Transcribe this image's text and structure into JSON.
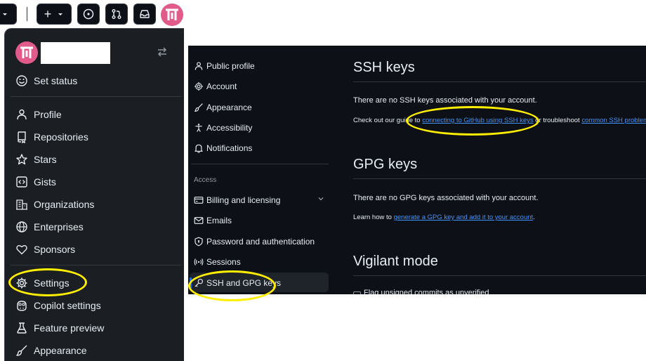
{
  "topbar": {
    "buttons": [
      "dropdown",
      "create-new",
      "issues",
      "pull-requests",
      "inbox"
    ],
    "plus_label": "+"
  },
  "menu": {
    "set_status": "Set status",
    "items": [
      {
        "label": "Profile",
        "icon": "person-icon"
      },
      {
        "label": "Repositories",
        "icon": "repo-icon"
      },
      {
        "label": "Stars",
        "icon": "star-icon"
      },
      {
        "label": "Gists",
        "icon": "code-square-icon"
      },
      {
        "label": "Organizations",
        "icon": "organization-icon"
      },
      {
        "label": "Enterprises",
        "icon": "globe-icon"
      },
      {
        "label": "Sponsors",
        "icon": "heart-icon"
      },
      {
        "label": "Settings",
        "icon": "gear-icon"
      },
      {
        "label": "Copilot settings",
        "icon": "copilot-icon"
      },
      {
        "label": "Feature preview",
        "icon": "beaker-icon"
      },
      {
        "label": "Appearance",
        "icon": "paintbrush-icon"
      }
    ]
  },
  "sidebar": {
    "items_top": [
      {
        "label": "Public profile",
        "icon": "person-icon"
      },
      {
        "label": "Account",
        "icon": "gear-icon"
      },
      {
        "label": "Appearance",
        "icon": "paintbrush-icon"
      },
      {
        "label": "Accessibility",
        "icon": "accessibility-icon"
      },
      {
        "label": "Notifications",
        "icon": "bell-icon"
      }
    ],
    "access_heading": "Access",
    "items_access": [
      {
        "label": "Billing and licensing",
        "icon": "credit-card-icon"
      },
      {
        "label": "Emails",
        "icon": "mail-icon"
      },
      {
        "label": "Password and authentication",
        "icon": "shield-lock-icon"
      },
      {
        "label": "Sessions",
        "icon": "broadcast-icon"
      },
      {
        "label": "SSH and GPG keys",
        "icon": "key-icon"
      }
    ]
  },
  "content": {
    "ssh": {
      "title": "SSH keys",
      "empty": "There are no SSH keys associated with your account.",
      "guide_prefix": "Check out our guide to ",
      "guide_link": "connecting to GitHub using SSH keys",
      "guide_mid": " or troubleshoot ",
      "guide_link2": "common SSH problems",
      "guide_suffix": "."
    },
    "gpg": {
      "title": "GPG keys",
      "empty": "There are no GPG keys associated with your account.",
      "learn_prefix": "Learn how to ",
      "learn_link": "generate a GPG key and add it to your account",
      "learn_suffix": "."
    },
    "vigilant": {
      "title": "Vigilant mode",
      "checkbox_label": "Flag unsigned commits as unverified"
    }
  },
  "colors": {
    "highlight": "#ffee00",
    "link": "#4493f8",
    "menu_bg": "#1b1f24",
    "page_bg": "#0d1117",
    "text": "#e6edf3",
    "avatar": "#e05a8a"
  }
}
